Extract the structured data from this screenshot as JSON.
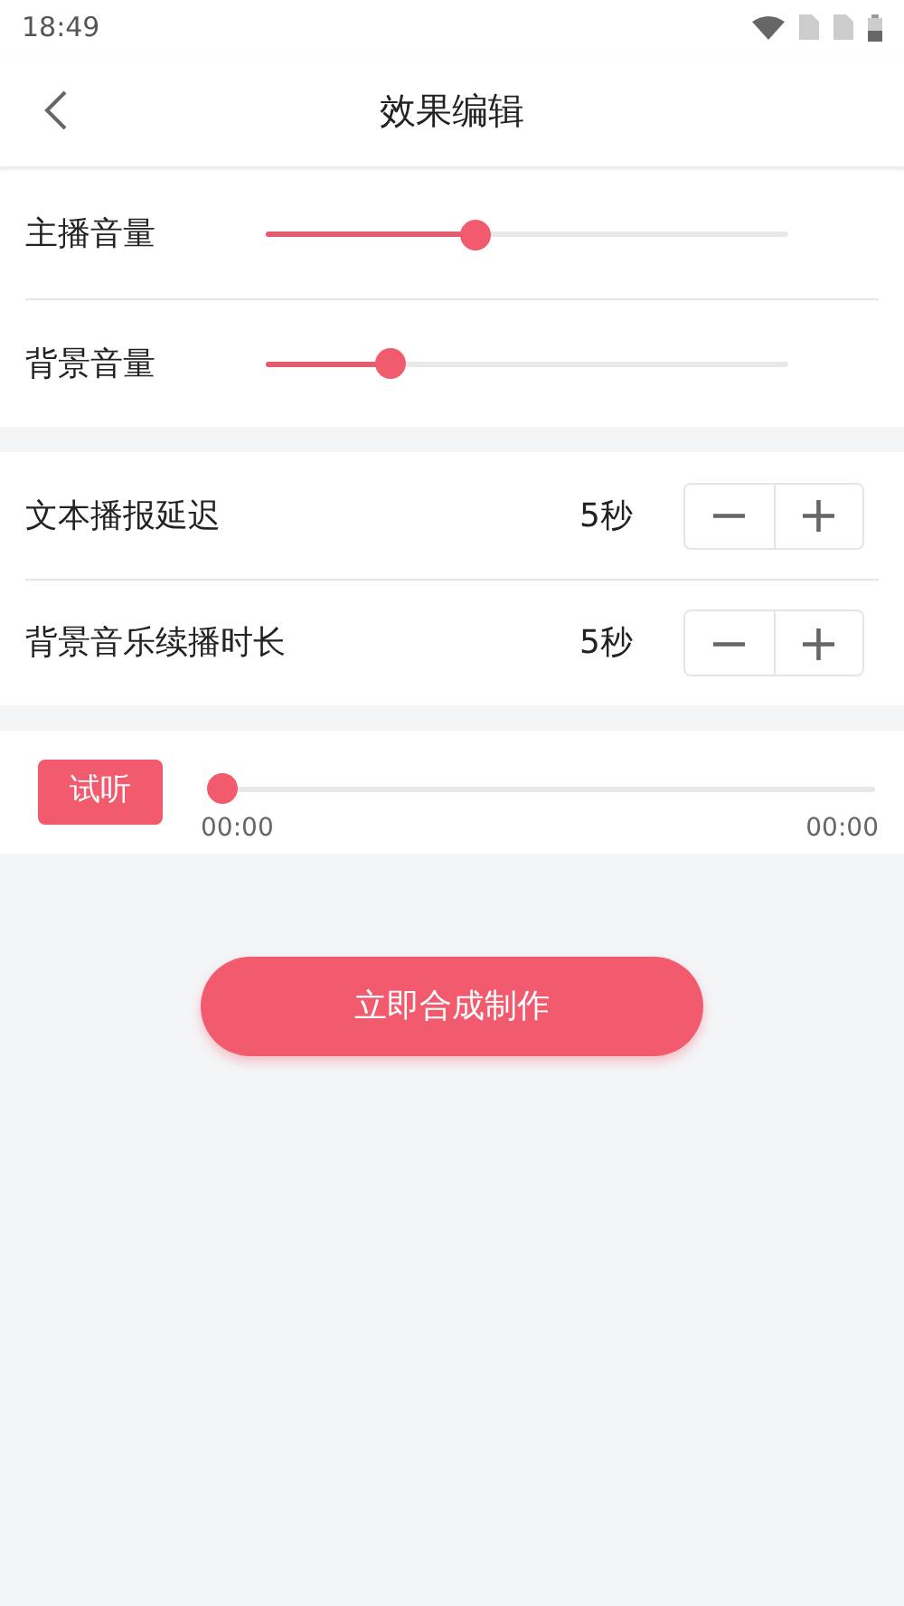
{
  "status_bar": {
    "time": "18:49"
  },
  "header": {
    "title": "效果编辑"
  },
  "volumes": [
    {
      "label": "主播音量",
      "level": 0.4
    },
    {
      "label": "背景音量",
      "level": 0.24
    }
  ],
  "timings": [
    {
      "label": "文本播报延迟",
      "value": "5秒",
      "minus": "−",
      "plus": "+"
    },
    {
      "label": "背景音乐续播时长",
      "value": "5秒",
      "minus": "−",
      "plus": "+"
    }
  ],
  "player": {
    "button": "试听",
    "level": 0,
    "current": "00:00",
    "total": "00:00"
  },
  "submit": "立即合成制作"
}
